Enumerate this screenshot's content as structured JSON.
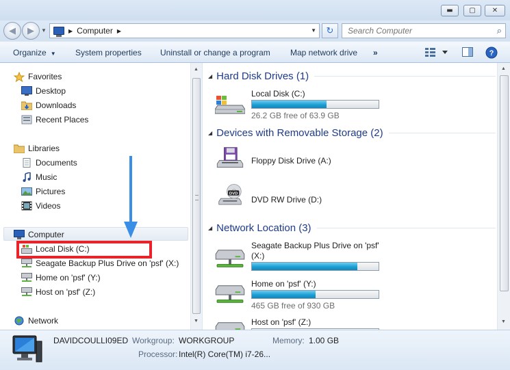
{
  "window": {
    "buttons": {
      "minimize": "▬",
      "maximize": "▢",
      "close": "✕"
    }
  },
  "address": {
    "crumb": "Computer",
    "search_placeholder": "Search Computer"
  },
  "toolbar": {
    "organize": "Organize",
    "system_properties": "System properties",
    "uninstall": "Uninstall or change a program",
    "map_network": "Map network drive",
    "more": "»"
  },
  "nav": {
    "favorites": "Favorites",
    "desktop": "Desktop",
    "downloads": "Downloads",
    "recent": "Recent Places",
    "libraries": "Libraries",
    "documents": "Documents",
    "music": "Music",
    "pictures": "Pictures",
    "videos": "Videos",
    "computer": "Computer",
    "local_disk": "Local Disk (C:)",
    "seagate": "Seagate Backup Plus Drive on 'psf' (X:)",
    "home": "Home on 'psf' (Y:)",
    "host": "Host on 'psf' (Z:)",
    "network": "Network"
  },
  "groups": {
    "hard_disks": "Hard Disk Drives (1)",
    "removable": "Devices with Removable Storage (2)",
    "network": "Network Location (3)"
  },
  "drives": {
    "local": {
      "name": "Local Disk (C:)",
      "free": "26.2 GB free of 63.9 GB",
      "used_fraction": 0.59
    },
    "floppy": {
      "name": "Floppy Disk Drive (A:)"
    },
    "dvd": {
      "name": "DVD RW Drive (D:)",
      "badge": "DVD"
    },
    "seagate": {
      "name1": "Seagate Backup Plus Drive on 'psf'",
      "name2": "(X:)",
      "used_fraction": 0.83
    },
    "home": {
      "name": "Home on 'psf' (Y:)",
      "free": "465 GB free of 930 GB",
      "used_fraction": 0.5
    },
    "host": {
      "name": "Host on 'psf' (Z:)"
    }
  },
  "details": {
    "computer_name": "DAVIDCOULLI09ED",
    "workgroup_label": "Workgroup:",
    "workgroup": "WORKGROUP",
    "memory_label": "Memory:",
    "memory": "1.00 GB",
    "processor_label": "Processor:",
    "processor": "Intel(R) Core(TM) i7-26..."
  },
  "colors": {
    "annotation_box": "#e8232a",
    "annotation_arrow": "#3a8ee6",
    "bar_fill": "#1c9fd4"
  }
}
